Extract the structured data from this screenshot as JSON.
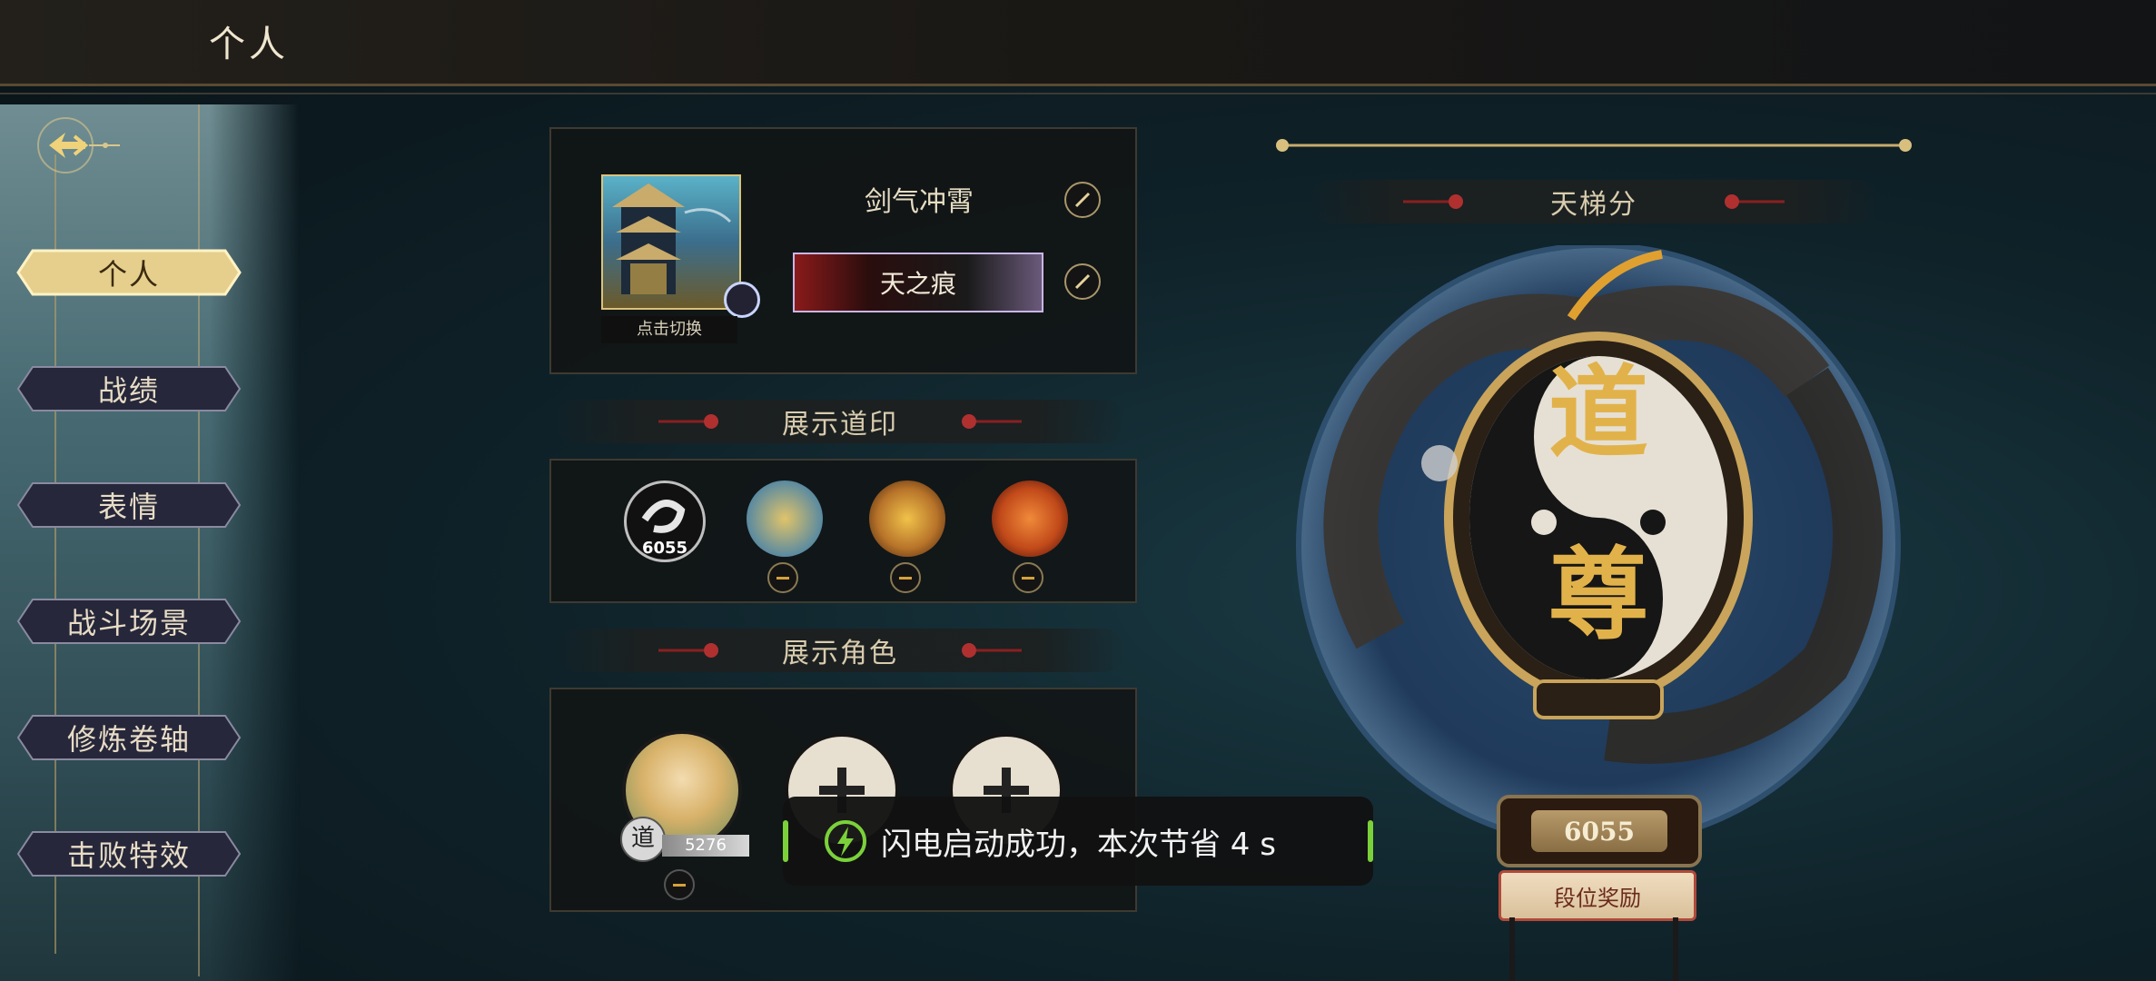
{
  "header": {
    "title": "个人"
  },
  "sidebar": {
    "items": [
      {
        "label": "个人",
        "active": true
      },
      {
        "label": "战绩"
      },
      {
        "label": "表情"
      },
      {
        "label": "战斗场景"
      },
      {
        "label": "修炼卷轴"
      },
      {
        "label": "击败特效"
      }
    ]
  },
  "profile": {
    "switch_label": "点击切换",
    "name": "剑气冲霄",
    "title_badge": "天之痕",
    "edit_icon": "brush-icon"
  },
  "seals_section": {
    "title": "展示道印",
    "seals": [
      {
        "icon": "ink-swirl-seal-icon",
        "value": "6055",
        "removable": false,
        "color": "#d9d9d9"
      },
      {
        "icon": "dragon-water-seal-icon",
        "removable": true,
        "color": "#c9a14a"
      },
      {
        "icon": "gold-crest-seal-icon",
        "removable": true,
        "color": "#b8742a"
      },
      {
        "icon": "fire-phoenix-seal-icon",
        "removable": true,
        "color": "#c24a1a"
      }
    ]
  },
  "characters_section": {
    "title": "展示角色",
    "characters": [
      {
        "icon": "character-portrait-icon",
        "badge": "道",
        "score": "5276",
        "removable": true
      },
      {
        "icon": "add-icon",
        "empty": true
      },
      {
        "icon": "add-icon",
        "empty": true
      }
    ]
  },
  "ladder": {
    "title": "天梯分",
    "rank_glyph_top": "道",
    "rank_glyph_bottom": "尊",
    "score": "6055",
    "reward_button": "段位奖励"
  },
  "toast": {
    "text": "闪电启动成功，本次节省 4 s",
    "icon": "lightning-icon"
  },
  "colors": {
    "gold": "#c9ab6c",
    "accent_green": "#7bd13a",
    "panel": "#121414"
  }
}
